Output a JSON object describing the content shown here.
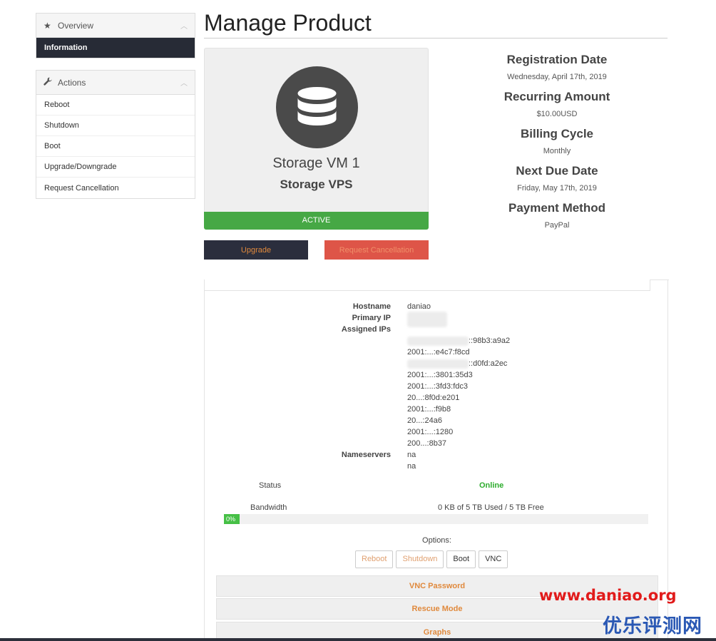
{
  "sidebar": {
    "overview": {
      "header": "Overview",
      "items": [
        "Information"
      ]
    },
    "actions": {
      "header": "Actions",
      "items": [
        "Reboot",
        "Shutdown",
        "Boot",
        "Upgrade/Downgrade",
        "Request Cancellation"
      ]
    }
  },
  "page": {
    "title": "Manage Product"
  },
  "product": {
    "name": "Storage VM 1",
    "type": "Storage VPS",
    "status": "ACTIVE",
    "upgrade_label": "Upgrade",
    "cancel_label": "Request Cancellation"
  },
  "details": [
    {
      "label": "Registration Date",
      "value": "Wednesday, April 17th, 2019"
    },
    {
      "label": "Recurring Amount",
      "value": "$10.00USD"
    },
    {
      "label": "Billing Cycle",
      "value": "Monthly"
    },
    {
      "label": "Next Due Date",
      "value": "Friday, May 17th, 2019"
    },
    {
      "label": "Payment Method",
      "value": "PayPal"
    }
  ],
  "server": {
    "hostname_label": "Hostname",
    "hostname": "daniao",
    "primary_ip_label": "Primary IP",
    "assigned_ips_label": "Assigned IPs",
    "assigned_ips_visible": [
      "::98b3:a9a2",
      "2001:...:e4c7:f8cd",
      "::d0fd:a2ec",
      "2001:...:3801:35d3",
      "2001:...:3fd3:fdc3",
      "20...:8f0d:e201",
      "2001:...:f9b8",
      "20...:24a6",
      "2001:...:1280",
      "200...:8b37"
    ],
    "nameservers_label": "Nameservers",
    "nameservers": [
      "na",
      "na"
    ],
    "status_label": "Status",
    "status": "Online",
    "bandwidth_label": "Bandwidth",
    "bandwidth": "0 KB of 5 TB Used / 5 TB Free",
    "bandwidth_percent": 0,
    "bandwidth_percent_label": "0%",
    "options_label": "Options:",
    "option_buttons": [
      "Reboot",
      "Shutdown",
      "Boot",
      "VNC"
    ],
    "accordions": [
      "VNC Password",
      "Rescue Mode",
      "Graphs"
    ]
  },
  "watermark": {
    "url": "www.daniao.org",
    "cn": "优乐评测网"
  },
  "colors": {
    "active_green": "#46a845",
    "online_green": "#2eac2e",
    "accent_orange": "#e0893c",
    "danger_red": "#de5548",
    "dark_nav": "#272b36"
  }
}
